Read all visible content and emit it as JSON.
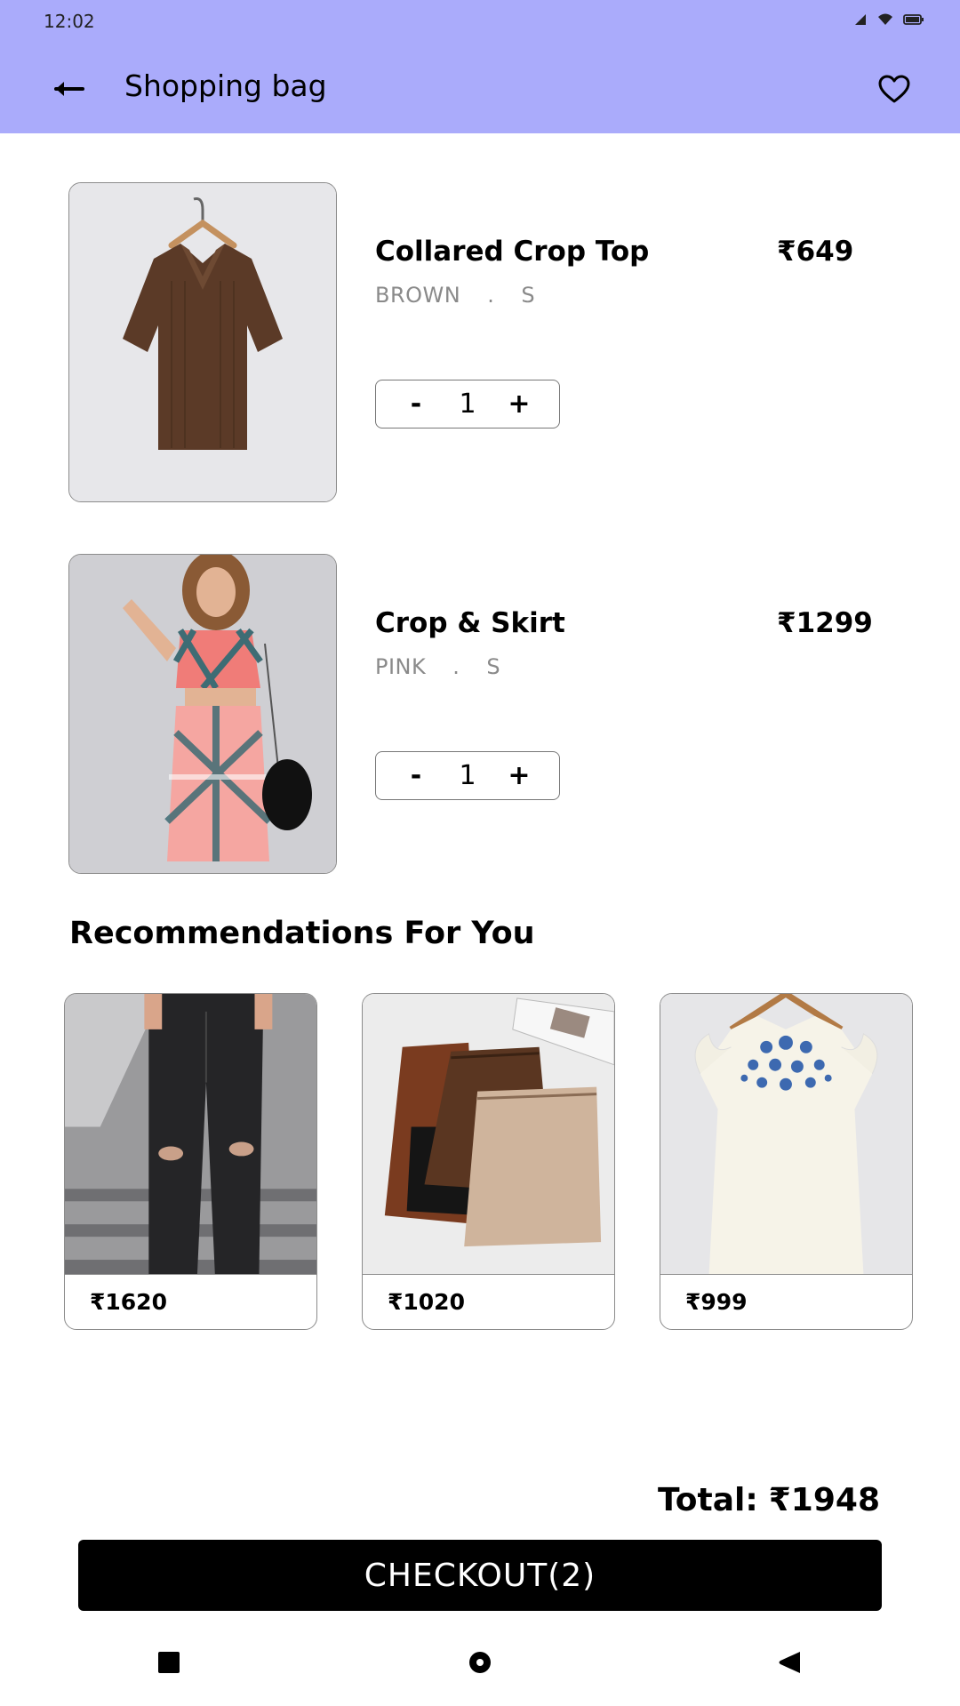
{
  "status_bar": {
    "time": "12:02",
    "icons": [
      "signal-icon",
      "wifi-icon",
      "battery-icon"
    ]
  },
  "header": {
    "title": "Shopping bag",
    "back_icon": "arrow-left-icon",
    "favorite_icon": "heart-outline-icon",
    "background": "#aaabfb"
  },
  "cart": {
    "items": [
      {
        "name": "Collared Crop Top",
        "color": "BROWN",
        "separator": ".",
        "size": "S",
        "price": "₹649",
        "qty_minus": "-",
        "quantity": "1",
        "qty_plus": "+"
      },
      {
        "name": "Crop & Skirt",
        "color": "PINK",
        "separator": ".",
        "size": "S",
        "price": "₹1299",
        "qty_minus": "-",
        "quantity": "1",
        "qty_plus": "+"
      }
    ]
  },
  "recommendations": {
    "title": "Recommendations For You",
    "items": [
      {
        "price": "₹1620"
      },
      {
        "price": "₹1020"
      },
      {
        "price": "₹999"
      }
    ]
  },
  "footer": {
    "total_label": "Total:",
    "total_value": "₹1948",
    "checkout_label": "CHECKOUT(2)"
  },
  "nav": {
    "icons": [
      "recents-square-icon",
      "home-circle-icon",
      "back-triangle-icon"
    ]
  }
}
